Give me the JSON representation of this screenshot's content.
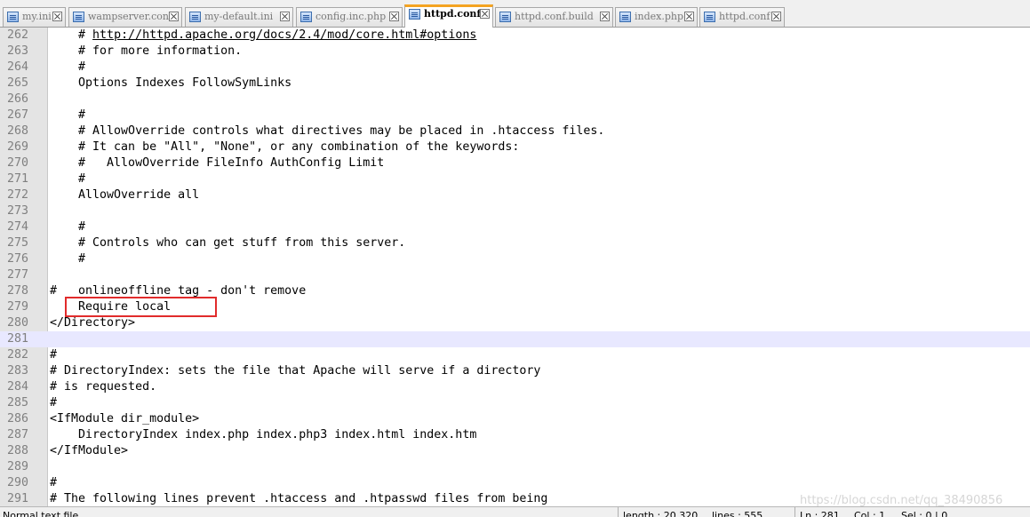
{
  "tabs": [
    {
      "label": "my.ini",
      "active": false
    },
    {
      "label": "wampserver.conf",
      "active": false
    },
    {
      "label": "my-default.ini",
      "active": false
    },
    {
      "label": "config.inc.php",
      "active": false
    },
    {
      "label": "httpd.conf",
      "active": true
    },
    {
      "label": "httpd.conf.build",
      "active": false
    },
    {
      "label": "index.php",
      "active": false
    },
    {
      "label": "httpd.conf",
      "active": false
    }
  ],
  "editor": {
    "current_line": "281",
    "lines": [
      {
        "num": "262",
        "text": "    # http://httpd.apache.org/docs/2.4/mod/core.html#options"
      },
      {
        "num": "263",
        "text": "    # for more information."
      },
      {
        "num": "264",
        "text": "    #"
      },
      {
        "num": "265",
        "text": "    Options Indexes FollowSymLinks"
      },
      {
        "num": "266",
        "text": ""
      },
      {
        "num": "267",
        "text": "    #"
      },
      {
        "num": "268",
        "text": "    # AllowOverride controls what directives may be placed in .htaccess files."
      },
      {
        "num": "269",
        "text": "    # It can be \"All\", \"None\", or any combination of the keywords:"
      },
      {
        "num": "270",
        "text": "    #   AllowOverride FileInfo AuthConfig Limit"
      },
      {
        "num": "271",
        "text": "    #"
      },
      {
        "num": "272",
        "text": "    AllowOverride all"
      },
      {
        "num": "273",
        "text": ""
      },
      {
        "num": "274",
        "text": "    #"
      },
      {
        "num": "275",
        "text": "    # Controls who can get stuff from this server."
      },
      {
        "num": "276",
        "text": "    #"
      },
      {
        "num": "277",
        "text": ""
      },
      {
        "num": "278",
        "text": "#   onlineoffline tag - don't remove"
      },
      {
        "num": "279",
        "text": "    Require local"
      },
      {
        "num": "280",
        "text": "</Directory>"
      },
      {
        "num": "281",
        "text": ""
      },
      {
        "num": "282",
        "text": "#"
      },
      {
        "num": "283",
        "text": "# DirectoryIndex: sets the file that Apache will serve if a directory"
      },
      {
        "num": "284",
        "text": "# is requested."
      },
      {
        "num": "285",
        "text": "#"
      },
      {
        "num": "286",
        "text": "<IfModule dir_module>"
      },
      {
        "num": "287",
        "text": "    DirectoryIndex index.php index.php3 index.html index.htm"
      },
      {
        "num": "288",
        "text": "</IfModule>"
      },
      {
        "num": "289",
        "text": ""
      },
      {
        "num": "290",
        "text": "#"
      },
      {
        "num": "291",
        "text": "# The following lines prevent .htaccess and .htpasswd files from being"
      }
    ]
  },
  "status": {
    "file_type": "Normal text file",
    "length": "length : 20,320",
    "lines": "lines : 555",
    "position": "Ln : 281",
    "column": "Col : 1",
    "selection": "Sel : 0 | 0"
  },
  "watermark": "https://blog.csdn.net/qq_38490856",
  "colors": {
    "active_tab_accent": "#f4a321",
    "current_line_bg": "#e8e8ff",
    "gutter_bg": "#e4e4e4",
    "highlight_box": "#e12b2b"
  }
}
